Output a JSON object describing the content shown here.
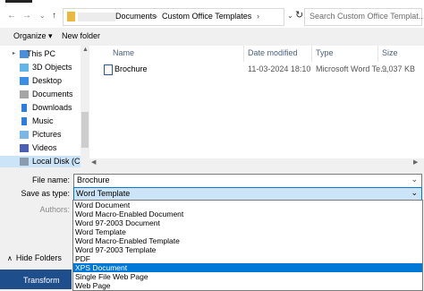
{
  "nav_buttons": {
    "back": "←",
    "forward": "→",
    "recent": "⌄",
    "up": "↑"
  },
  "address": {
    "crumbs": [
      "Documents",
      "Custom Office Templates"
    ],
    "separator": "›",
    "dropdown": "⌄",
    "refresh": "↻"
  },
  "search": {
    "placeholder": "Search Custom Office Templat..."
  },
  "toolbar": {
    "organize": "Organize ▾",
    "new_folder": "New folder"
  },
  "sidebar": {
    "items": [
      {
        "label": "This PC",
        "icon": "pc-icon",
        "color": "#4a90d9"
      },
      {
        "label": "3D Objects",
        "icon": "cube-icon",
        "color": "#61b5e8"
      },
      {
        "label": "Desktop",
        "icon": "desktop-icon",
        "color": "#3a8ee6"
      },
      {
        "label": "Documents",
        "icon": "documents-icon",
        "color": "#a6a6a6"
      },
      {
        "label": "Downloads",
        "icon": "download-icon",
        "color": "#2b7de1"
      },
      {
        "label": "Music",
        "icon": "music-icon",
        "color": "#2b7de1"
      },
      {
        "label": "Pictures",
        "icon": "pictures-icon",
        "color": "#7ab6e8"
      },
      {
        "label": "Videos",
        "icon": "videos-icon",
        "color": "#4a5fb5"
      },
      {
        "label": "Local Disk (C:)",
        "icon": "disk-icon",
        "color": "#8a9db0"
      }
    ]
  },
  "columns": [
    "Name",
    "Date modified",
    "Type",
    "Size"
  ],
  "files": [
    {
      "name": "Brochure",
      "date": "11-03-2024 18:10",
      "type": "Microsoft Word Te...",
      "size": "9,037 KB"
    }
  ],
  "form": {
    "file_name_label": "File name:",
    "file_name_value": "Brochure",
    "save_type_label": "Save as type:",
    "save_type_value": "Word Template",
    "authors_label": "Authors:",
    "type_options": [
      "Word Document",
      "Word Macro-Enabled Document",
      "Word 97-2003 Document",
      "Word Template",
      "Word Macro-Enabled Template",
      "Word 97-2003 Template",
      "PDF",
      "XPS Document",
      "Single File Web Page",
      "Web Page"
    ],
    "highlighted_option": "XPS Document"
  },
  "hide_folders": {
    "chevron": "∧",
    "label": "Hide Folders"
  },
  "background_app": {
    "label": "Transform"
  },
  "colors": {
    "accent": "#0078d7",
    "selection": "#cce4f7",
    "word_blue": "#1e4e8c"
  }
}
